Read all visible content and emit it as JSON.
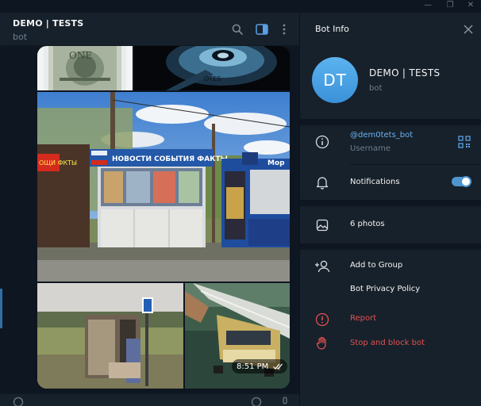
{
  "window": {
    "buttons": [
      {
        "name": "minimize",
        "glyph": "—"
      },
      {
        "name": "maximize",
        "glyph": "❐"
      },
      {
        "name": "close",
        "glyph": "✕"
      }
    ]
  },
  "chat": {
    "title": "DEMO | TESTS",
    "subtitle": "bot",
    "header_icons": [
      "search-icon",
      "sidebar-panel-icon",
      "more-vertical-icon"
    ],
    "message": {
      "time": "8:51 PM",
      "status": "read",
      "photos": [
        {
          "name": "photo-dollar-bill"
        },
        {
          "name": "photo-hard-drive"
        },
        {
          "name": "photo-news-kiosk",
          "sign_text": "НОВОСТИ СОБЫТИЯ ФАКТЫ",
          "left_sign": "ОЩИ ФКТЫ",
          "right_sign": "Мор"
        },
        {
          "name": "photo-bus-stop"
        },
        {
          "name": "photo-bridge-van"
        }
      ]
    }
  },
  "info_panel": {
    "title": "Bot Info",
    "profile": {
      "initials": "DT",
      "name": "DEMO | TESTS",
      "status": "bot"
    },
    "username": {
      "value": "@dem0tets_bot",
      "label": "Username"
    },
    "notifications": {
      "label": "Notifications",
      "enabled": true
    },
    "media": {
      "label": "6 photos"
    },
    "actions": [
      {
        "label": "Add to Group",
        "icon": "add-user-icon",
        "danger": false
      },
      {
        "label": "Bot Privacy Policy",
        "icon": "",
        "danger": false
      }
    ],
    "danger_actions": [
      {
        "label": "Report",
        "icon": "alert-circle-icon"
      },
      {
        "label": "Stop and block bot",
        "icon": "hand-stop-icon"
      }
    ]
  },
  "colors": {
    "background": "#0e1621",
    "panel": "#17212b",
    "accent": "#6ab2f2",
    "danger": "#e3514f",
    "muted": "#6d7f8f",
    "avatar": "#4aa3e6"
  }
}
